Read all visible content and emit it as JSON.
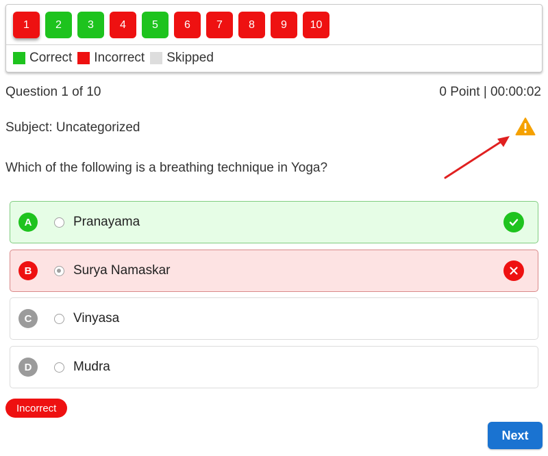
{
  "navigator": {
    "questions": [
      {
        "label": "1",
        "status": "incorrect",
        "current": true
      },
      {
        "label": "2",
        "status": "correct",
        "current": false
      },
      {
        "label": "3",
        "status": "correct",
        "current": false
      },
      {
        "label": "4",
        "status": "incorrect",
        "current": false
      },
      {
        "label": "5",
        "status": "correct",
        "current": false
      },
      {
        "label": "6",
        "status": "incorrect",
        "current": false
      },
      {
        "label": "7",
        "status": "incorrect",
        "current": false
      },
      {
        "label": "8",
        "status": "incorrect",
        "current": false
      },
      {
        "label": "9",
        "status": "incorrect",
        "current": false
      },
      {
        "label": "10",
        "status": "incorrect",
        "current": false
      }
    ],
    "legend": [
      {
        "label": "Correct",
        "color": "#1ec31e"
      },
      {
        "label": "Incorrect",
        "color": "#ee1111"
      },
      {
        "label": "Skipped",
        "color": "#dddddd"
      }
    ]
  },
  "meta": {
    "progress": "Question 1 of 10",
    "score_time": "0 Point | 00:00:02",
    "subject": "Subject: Uncategorized"
  },
  "question": {
    "text": "Which of the following is a breathing technique in Yoga?",
    "report_icon": "warning-icon"
  },
  "options": [
    {
      "letter": "A",
      "text": "Pranayama",
      "state": "correct",
      "selected": false
    },
    {
      "letter": "B",
      "text": "Surya Namaskar",
      "state": "incorrect",
      "selected": true
    },
    {
      "letter": "C",
      "text": "Vinyasa",
      "state": "neutral",
      "selected": false
    },
    {
      "letter": "D",
      "text": "Mudra",
      "state": "neutral",
      "selected": false
    }
  ],
  "result": {
    "label": "Incorrect"
  },
  "actions": {
    "next_label": "Next"
  },
  "colors": {
    "correct": "#1ec31e",
    "incorrect": "#ee1111",
    "accent": "#1a73d1",
    "warning": "#f5a100"
  }
}
